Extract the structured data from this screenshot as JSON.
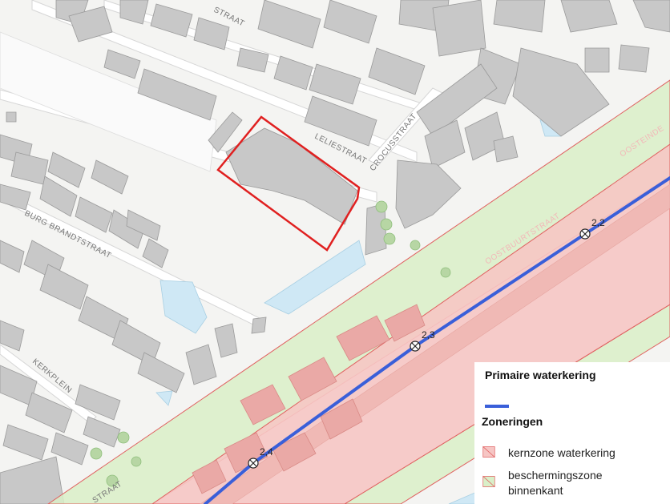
{
  "map": {
    "streets": {
      "burg_brandtstraat": "BURG BRANDTSTRAAT",
      "leliestraat": "LELIESTRAAT",
      "crocusstraat": "CROCUSSTRAAT",
      "kerkplein": "KERKPLEIN",
      "oostbuurtstraat": "OOSTBUURTSTRAAT",
      "oosteinde": "OOSTEINDE",
      "straat_fragment_top": "STRAAT",
      "straat_fragment_bottom": "STRAAT"
    },
    "km_markers": [
      "2,2",
      "2,3",
      "2,4"
    ],
    "colors": {
      "waterkering_line": "#3a5fd9",
      "kernzone_fill": "#f6c6c4",
      "kernzone_stroke": "#e06060",
      "beschermingszone_fill": "#d9efc8",
      "highlight_outline": "#e02020",
      "water": "#cfe8f5",
      "buildings": "#c8c8c8",
      "background": "#f4f4f2"
    }
  },
  "legend": {
    "title_line": "Primaire waterkering",
    "title_zones": "Zoneringen",
    "items": [
      {
        "label": "kernzone waterkering"
      },
      {
        "label": "beschermingszone binnenkant"
      }
    ]
  }
}
